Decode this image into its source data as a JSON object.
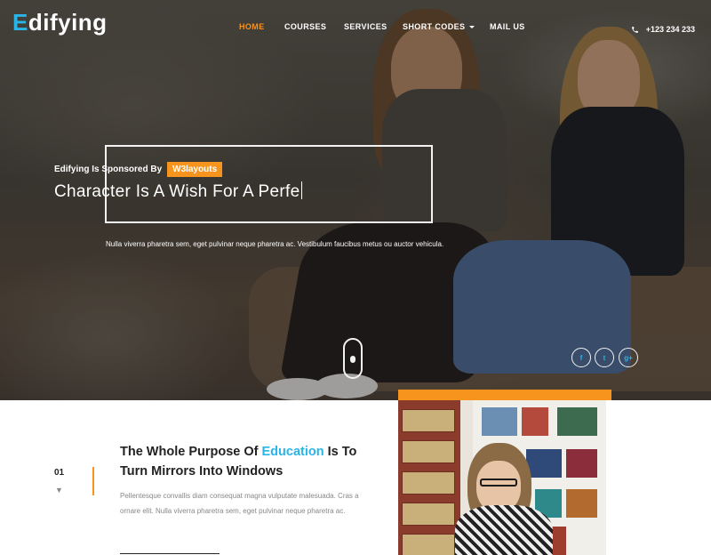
{
  "brand": {
    "logo_first": "E",
    "logo_rest": "difying"
  },
  "nav": {
    "items": [
      {
        "label": "HOME"
      },
      {
        "label": "COURSES"
      },
      {
        "label": "SERVICES"
      },
      {
        "label": "SHORT CODES"
      },
      {
        "label": "MAIL US"
      }
    ],
    "phone": "+123 234 233"
  },
  "hero": {
    "sponsor_text": "Edifying Is Sponsored By",
    "sponsor_badge": "W3layouts",
    "headline": "Character Is A Wish For A Perfe",
    "subtext": "Nulla viverra pharetra sem, eget pulvinar neque pharetra ac. Vestibulum faucibus metus ou auctor vehicula."
  },
  "social": [
    {
      "label": "f",
      "icon": "facebook-icon"
    },
    {
      "label": "t",
      "icon": "twitter-icon"
    },
    {
      "label": "g+",
      "icon": "google-plus-icon"
    }
  ],
  "about": {
    "number": "01",
    "title_pre": "The Whole Purpose Of",
    "title_highlight": "Education",
    "title_post": "Is To Turn Mirrors Into Windows",
    "paragraph": "Pellentesque convallis diam consequat magna vulputate malesuada. Cras a ornare elit. Nulla viverra pharetra sem, eget pulvinar neque pharetra ac."
  },
  "colors": {
    "accent": "#f7941d",
    "brand_blue": "#29b5e8"
  }
}
